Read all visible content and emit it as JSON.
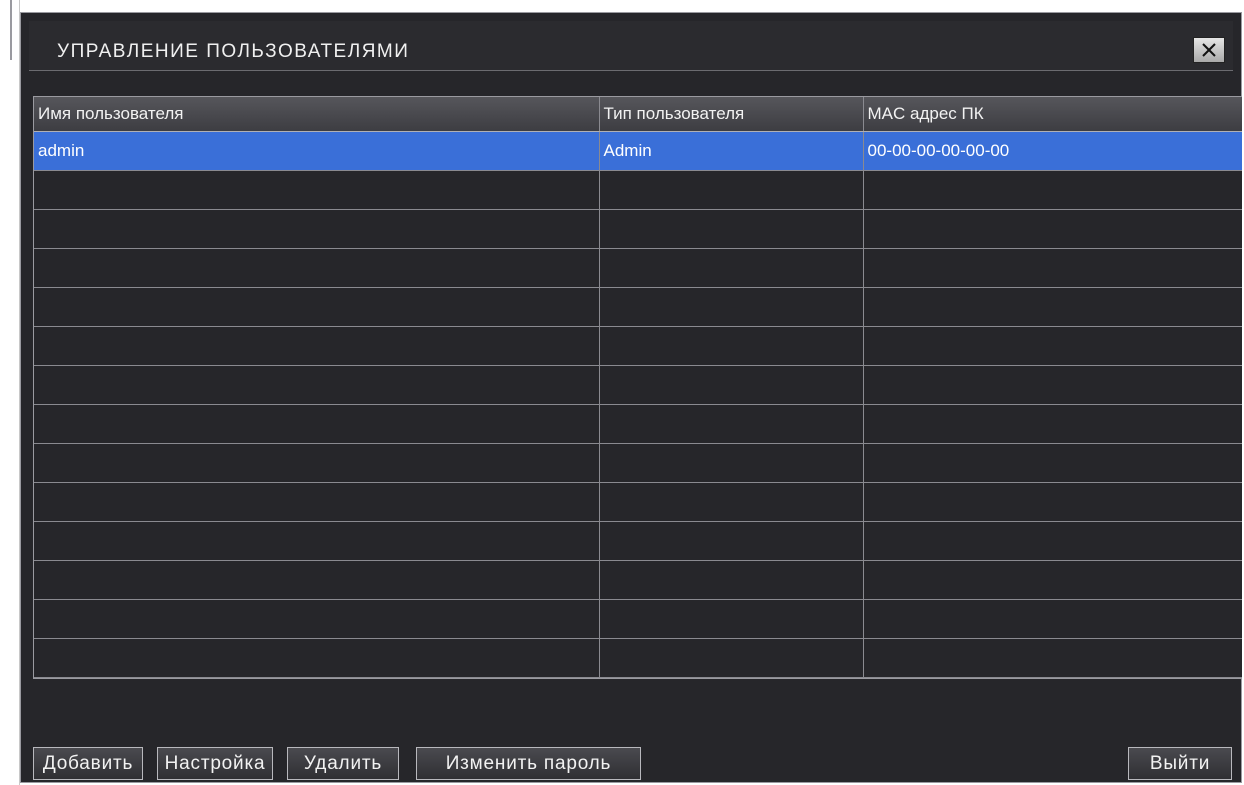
{
  "window": {
    "title": "УПРАВЛЕНИЕ ПОЛЬЗОВАТЕЛЯМИ",
    "close_icon": "close-icon"
  },
  "table": {
    "columns": [
      "Имя пользователя",
      "Тип пользователя",
      "MAC адрес ПК"
    ],
    "rows": [
      {
        "name": "admin",
        "type": "Admin",
        "mac": "00-00-00-00-00-00",
        "selected": true
      },
      {
        "name": "",
        "type": "",
        "mac": ""
      },
      {
        "name": "",
        "type": "",
        "mac": ""
      },
      {
        "name": "",
        "type": "",
        "mac": ""
      },
      {
        "name": "",
        "type": "",
        "mac": ""
      },
      {
        "name": "",
        "type": "",
        "mac": ""
      },
      {
        "name": "",
        "type": "",
        "mac": ""
      },
      {
        "name": "",
        "type": "",
        "mac": ""
      },
      {
        "name": "",
        "type": "",
        "mac": ""
      },
      {
        "name": "",
        "type": "",
        "mac": ""
      },
      {
        "name": "",
        "type": "",
        "mac": ""
      },
      {
        "name": "",
        "type": "",
        "mac": ""
      },
      {
        "name": "",
        "type": "",
        "mac": ""
      },
      {
        "name": "",
        "type": "",
        "mac": ""
      }
    ]
  },
  "buttons": {
    "add": "Добавить",
    "settings": "Настройка",
    "delete": "Удалить",
    "change_password": "Изменить пароль",
    "exit": "Выйти"
  },
  "colors": {
    "background": "#26262a",
    "selected_row": "#3a6fd8",
    "border": "#8a8a90",
    "text": "#f2f2f2"
  }
}
